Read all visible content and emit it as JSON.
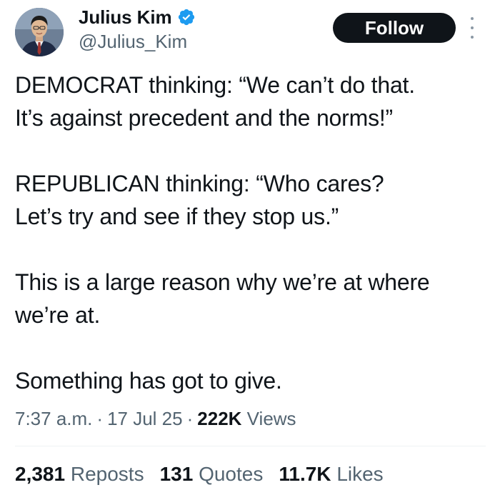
{
  "author": {
    "display_name": "Julius Kim",
    "handle": "@Julius_Kim",
    "verified": true,
    "verified_color": "#1d9bf0"
  },
  "follow_label": "Follow",
  "tweet": {
    "paragraphs": [
      {
        "line1": "DEMOCRAT thinking: “We can’t do that.",
        "line2": "It’s against precedent and the norms!”"
      },
      {
        "line1": "REPUBLICAN thinking: “Who cares?",
        "line2": "Let’s try and see if they stop us.”"
      },
      {
        "line1": "This is a large reason why we’re at where",
        "line2": "we’re at."
      },
      {
        "line1": "Something has got to give."
      }
    ]
  },
  "meta": {
    "time": "7:37 a.m.",
    "date": "17 Jul 25",
    "views_count": "222K",
    "views_label": "Views",
    "separator": "·"
  },
  "stats": {
    "reposts_count": "2,381",
    "reposts_label": "Reposts",
    "quotes_count": "131",
    "quotes_label": "Quotes",
    "likes_count": "11.7K",
    "likes_label": "Likes"
  },
  "colors": {
    "text_primary": "#0f1419",
    "text_secondary": "#536471",
    "follow_bg": "#0f1419",
    "divider": "#eff3f4"
  },
  "icons": {
    "verified": "verified-badge-icon",
    "more": "more-options-icon"
  }
}
